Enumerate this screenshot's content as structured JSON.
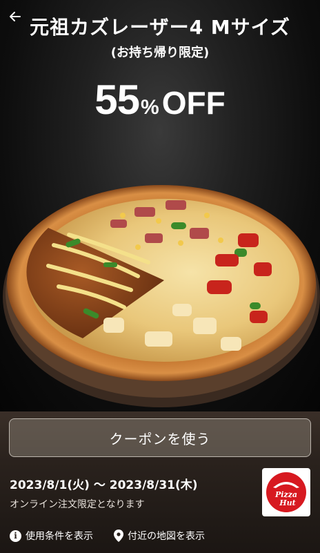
{
  "header": {
    "back_icon": "arrow-left-icon",
    "title": "元祖カズレーザー4 Mサイズ",
    "subtitle": "(お持ち帰り限定)",
    "discount_number": "55",
    "discount_percent": "%",
    "discount_off": "OFF"
  },
  "coupon": {
    "button_label": "クーポンを使う",
    "period": "2023/8/1(火) 〜 2023/8/31(木)",
    "note": "オンライン注文限定となります",
    "logo_line1": "Pizza",
    "logo_line2": "Hut"
  },
  "footer": {
    "terms_icon": "info-icon",
    "terms_label": "使用条件を表示",
    "map_icon": "map-pin-icon",
    "map_label": "付近の地図を表示"
  },
  "colors": {
    "logo_red": "#d71920",
    "button_border": "#bdb6ae",
    "panel_bg": "#2a221d"
  }
}
